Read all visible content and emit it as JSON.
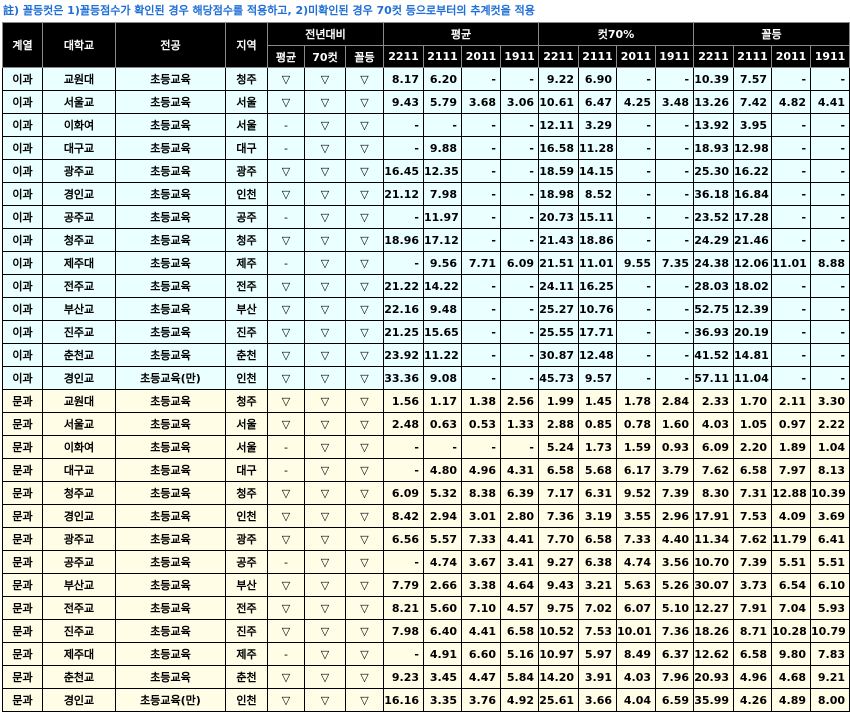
{
  "note": "註) 꼴등컷은 1)꼴등점수가 확인된 경우 해당점수를 적용하고, 2)미확인된 경우 70컷 등으로부터의 추계컷을 적용",
  "headers": {
    "track": "계열",
    "school": "대학교",
    "major": "전공",
    "region": "지역",
    "compare_group": "전년대비",
    "compare_cols": [
      "평균",
      "70컷",
      "꼴등"
    ],
    "groups": [
      "평균",
      "컷70%",
      "꼴등"
    ],
    "years": [
      "2211",
      "2111",
      "2011",
      "1911"
    ]
  },
  "rows": [
    {
      "track": "이과",
      "school": "교원대",
      "major": "초등교육",
      "region": "청주",
      "cmp": [
        "▽",
        "▽",
        "▽"
      ],
      "avg": [
        "8.17",
        "6.20",
        "-",
        "-"
      ],
      "cut70": [
        "9.22",
        "6.90",
        "-",
        "-"
      ],
      "last": [
        "10.39",
        "7.57",
        "-",
        "-"
      ]
    },
    {
      "track": "이과",
      "school": "서울교",
      "major": "초등교육",
      "region": "서울",
      "cmp": [
        "▽",
        "▽",
        "▽"
      ],
      "avg": [
        "9.43",
        "5.79",
        "3.68",
        "3.06"
      ],
      "cut70": [
        "10.61",
        "6.47",
        "4.25",
        "3.48"
      ],
      "last": [
        "13.26",
        "7.42",
        "4.82",
        "4.41"
      ]
    },
    {
      "track": "이과",
      "school": "이화여",
      "major": "초등교육",
      "region": "서울",
      "cmp": [
        "-",
        "▽",
        "▽"
      ],
      "avg": [
        "-",
        "-",
        "-",
        "-"
      ],
      "cut70": [
        "12.11",
        "3.29",
        "-",
        "-"
      ],
      "last": [
        "13.92",
        "3.95",
        "-",
        "-"
      ]
    },
    {
      "track": "이과",
      "school": "대구교",
      "major": "초등교육",
      "region": "대구",
      "cmp": [
        "-",
        "▽",
        "▽"
      ],
      "avg": [
        "-",
        "9.88",
        "-",
        "-"
      ],
      "cut70": [
        "16.58",
        "11.28",
        "-",
        "-"
      ],
      "last": [
        "18.93",
        "12.98",
        "-",
        "-"
      ]
    },
    {
      "track": "이과",
      "school": "광주교",
      "major": "초등교육",
      "region": "광주",
      "cmp": [
        "▽",
        "▽",
        "▽"
      ],
      "avg": [
        "16.45",
        "12.35",
        "-",
        "-"
      ],
      "cut70": [
        "18.59",
        "14.15",
        "-",
        "-"
      ],
      "last": [
        "25.30",
        "16.22",
        "-",
        "-"
      ]
    },
    {
      "track": "이과",
      "school": "경인교",
      "major": "초등교육",
      "region": "인천",
      "cmp": [
        "▽",
        "▽",
        "▽"
      ],
      "avg": [
        "21.12",
        "7.98",
        "-",
        "-"
      ],
      "cut70": [
        "18.98",
        "8.52",
        "-",
        "-"
      ],
      "last": [
        "36.18",
        "16.84",
        "-",
        "-"
      ]
    },
    {
      "track": "이과",
      "school": "공주교",
      "major": "초등교육",
      "region": "공주",
      "cmp": [
        "-",
        "▽",
        "▽"
      ],
      "avg": [
        "-",
        "11.97",
        "-",
        "-"
      ],
      "cut70": [
        "20.73",
        "15.11",
        "-",
        "-"
      ],
      "last": [
        "23.52",
        "17.28",
        "-",
        "-"
      ]
    },
    {
      "track": "이과",
      "school": "청주교",
      "major": "초등교육",
      "region": "청주",
      "cmp": [
        "▽",
        "▽",
        "▽"
      ],
      "avg": [
        "18.96",
        "17.12",
        "-",
        "-"
      ],
      "cut70": [
        "21.43",
        "18.86",
        "-",
        "-"
      ],
      "last": [
        "24.29",
        "21.46",
        "-",
        "-"
      ]
    },
    {
      "track": "이과",
      "school": "제주대",
      "major": "초등교육",
      "region": "제주",
      "cmp": [
        "-",
        "▽",
        "▽"
      ],
      "avg": [
        "-",
        "9.56",
        "7.71",
        "6.09"
      ],
      "cut70": [
        "21.51",
        "11.01",
        "9.55",
        "7.35"
      ],
      "last": [
        "24.38",
        "12.06",
        "11.01",
        "8.88"
      ]
    },
    {
      "track": "이과",
      "school": "전주교",
      "major": "초등교육",
      "region": "전주",
      "cmp": [
        "▽",
        "▽",
        "▽"
      ],
      "avg": [
        "21.22",
        "14.22",
        "-",
        "-"
      ],
      "cut70": [
        "24.11",
        "16.25",
        "-",
        "-"
      ],
      "last": [
        "28.03",
        "18.02",
        "-",
        "-"
      ]
    },
    {
      "track": "이과",
      "school": "부산교",
      "major": "초등교육",
      "region": "부산",
      "cmp": [
        "▽",
        "▽",
        "▽"
      ],
      "avg": [
        "22.16",
        "9.48",
        "-",
        "-"
      ],
      "cut70": [
        "25.27",
        "10.76",
        "-",
        "-"
      ],
      "last": [
        "52.75",
        "12.39",
        "-",
        "-"
      ]
    },
    {
      "track": "이과",
      "school": "진주교",
      "major": "초등교육",
      "region": "진주",
      "cmp": [
        "▽",
        "▽",
        "▽"
      ],
      "avg": [
        "21.25",
        "15.65",
        "-",
        "-"
      ],
      "cut70": [
        "25.55",
        "17.71",
        "-",
        "-"
      ],
      "last": [
        "36.93",
        "20.19",
        "-",
        "-"
      ]
    },
    {
      "track": "이과",
      "school": "춘천교",
      "major": "초등교육",
      "region": "춘천",
      "cmp": [
        "▽",
        "▽",
        "▽"
      ],
      "avg": [
        "23.92",
        "11.22",
        "-",
        "-"
      ],
      "cut70": [
        "30.87",
        "12.48",
        "-",
        "-"
      ],
      "last": [
        "41.52",
        "14.81",
        "-",
        "-"
      ]
    },
    {
      "track": "이과",
      "school": "경인교",
      "major": "초등교육(만)",
      "region": "인천",
      "cmp": [
        "▽",
        "▽",
        "▽"
      ],
      "avg": [
        "33.36",
        "9.08",
        "-",
        "-"
      ],
      "cut70": [
        "45.73",
        "9.57",
        "-",
        "-"
      ],
      "last": [
        "57.11",
        "11.04",
        "-",
        "-"
      ]
    },
    {
      "track": "문과",
      "school": "교원대",
      "major": "초등교육",
      "region": "청주",
      "cmp": [
        "▽",
        "▽",
        "▽"
      ],
      "avg": [
        "1.56",
        "1.17",
        "1.38",
        "2.56"
      ],
      "cut70": [
        "1.99",
        "1.45",
        "1.78",
        "2.84"
      ],
      "last": [
        "2.33",
        "1.70",
        "2.11",
        "3.30"
      ]
    },
    {
      "track": "문과",
      "school": "서울교",
      "major": "초등교육",
      "region": "서울",
      "cmp": [
        "▽",
        "▽",
        "▽"
      ],
      "avg": [
        "2.48",
        "0.63",
        "0.53",
        "1.33"
      ],
      "cut70": [
        "2.88",
        "0.85",
        "0.78",
        "1.60"
      ],
      "last": [
        "4.03",
        "1.05",
        "0.97",
        "2.22"
      ]
    },
    {
      "track": "문과",
      "school": "이화여",
      "major": "초등교육",
      "region": "서울",
      "cmp": [
        "-",
        "▽",
        "▽"
      ],
      "avg": [
        "-",
        "-",
        "-",
        "-"
      ],
      "cut70": [
        "5.24",
        "1.73",
        "1.59",
        "0.93"
      ],
      "last": [
        "6.09",
        "2.20",
        "1.89",
        "1.04"
      ]
    },
    {
      "track": "문과",
      "school": "대구교",
      "major": "초등교육",
      "region": "대구",
      "cmp": [
        "-",
        "▽",
        "▽"
      ],
      "avg": [
        "-",
        "4.80",
        "4.96",
        "4.31"
      ],
      "cut70": [
        "6.58",
        "5.68",
        "6.17",
        "3.79"
      ],
      "last": [
        "7.62",
        "6.58",
        "7.97",
        "8.13"
      ]
    },
    {
      "track": "문과",
      "school": "청주교",
      "major": "초등교육",
      "region": "청주",
      "cmp": [
        "▽",
        "▽",
        "▽"
      ],
      "avg": [
        "6.09",
        "5.32",
        "8.38",
        "6.39"
      ],
      "cut70": [
        "7.17",
        "6.31",
        "9.52",
        "7.39"
      ],
      "last": [
        "8.30",
        "7.31",
        "12.88",
        "10.39"
      ]
    },
    {
      "track": "문과",
      "school": "경인교",
      "major": "초등교육",
      "region": "인천",
      "cmp": [
        "▽",
        "▽",
        "▽"
      ],
      "avg": [
        "8.42",
        "2.94",
        "3.01",
        "2.80"
      ],
      "cut70": [
        "7.36",
        "3.19",
        "3.55",
        "2.96"
      ],
      "last": [
        "17.91",
        "7.53",
        "4.09",
        "3.69"
      ]
    },
    {
      "track": "문과",
      "school": "광주교",
      "major": "초등교육",
      "region": "광주",
      "cmp": [
        "▽",
        "▽",
        "▽"
      ],
      "avg": [
        "6.56",
        "5.57",
        "7.33",
        "4.41"
      ],
      "cut70": [
        "7.70",
        "6.58",
        "7.33",
        "4.40"
      ],
      "last": [
        "11.34",
        "7.62",
        "11.79",
        "6.41"
      ]
    },
    {
      "track": "문과",
      "school": "공주교",
      "major": "초등교육",
      "region": "공주",
      "cmp": [
        "-",
        "▽",
        "▽"
      ],
      "avg": [
        "-",
        "4.74",
        "3.67",
        "3.41"
      ],
      "cut70": [
        "9.27",
        "6.38",
        "4.74",
        "3.56"
      ],
      "last": [
        "10.70",
        "7.39",
        "5.51",
        "5.51"
      ]
    },
    {
      "track": "문과",
      "school": "부산교",
      "major": "초등교육",
      "region": "부산",
      "cmp": [
        "▽",
        "▽",
        "▽"
      ],
      "avg": [
        "7.79",
        "2.66",
        "3.38",
        "4.64"
      ],
      "cut70": [
        "9.43",
        "3.21",
        "5.63",
        "5.26"
      ],
      "last": [
        "30.07",
        "3.73",
        "6.54",
        "6.10"
      ]
    },
    {
      "track": "문과",
      "school": "전주교",
      "major": "초등교육",
      "region": "전주",
      "cmp": [
        "▽",
        "▽",
        "▽"
      ],
      "avg": [
        "8.21",
        "5.60",
        "7.10",
        "4.57"
      ],
      "cut70": [
        "9.75",
        "7.02",
        "6.07",
        "5.10"
      ],
      "last": [
        "12.27",
        "7.91",
        "7.04",
        "5.93"
      ]
    },
    {
      "track": "문과",
      "school": "진주교",
      "major": "초등교육",
      "region": "진주",
      "cmp": [
        "▽",
        "▽",
        "▽"
      ],
      "avg": [
        "7.98",
        "6.40",
        "4.41",
        "6.58"
      ],
      "cut70": [
        "10.52",
        "7.53",
        "10.01",
        "7.36"
      ],
      "last": [
        "18.26",
        "8.71",
        "10.28",
        "10.79"
      ]
    },
    {
      "track": "문과",
      "school": "제주대",
      "major": "초등교육",
      "region": "제주",
      "cmp": [
        "-",
        "▽",
        "▽"
      ],
      "avg": [
        "-",
        "4.91",
        "6.60",
        "5.16"
      ],
      "cut70": [
        "10.97",
        "5.97",
        "8.49",
        "6.37"
      ],
      "last": [
        "12.62",
        "6.58",
        "9.80",
        "7.83"
      ]
    },
    {
      "track": "문과",
      "school": "춘천교",
      "major": "초등교육",
      "region": "춘천",
      "cmp": [
        "▽",
        "▽",
        "▽"
      ],
      "avg": [
        "9.23",
        "3.45",
        "4.47",
        "5.84"
      ],
      "cut70": [
        "14.20",
        "3.91",
        "4.03",
        "7.96"
      ],
      "last": [
        "20.93",
        "4.96",
        "4.68",
        "9.21"
      ]
    },
    {
      "track": "문과",
      "school": "경인교",
      "major": "초등교육(만)",
      "region": "인천",
      "cmp": [
        "▽",
        "▽",
        "▽"
      ],
      "avg": [
        "16.16",
        "3.35",
        "3.76",
        "4.92"
      ],
      "cut70": [
        "25.61",
        "3.66",
        "4.04",
        "6.59"
      ],
      "last": [
        "35.99",
        "4.26",
        "4.89",
        "8.00"
      ]
    }
  ]
}
